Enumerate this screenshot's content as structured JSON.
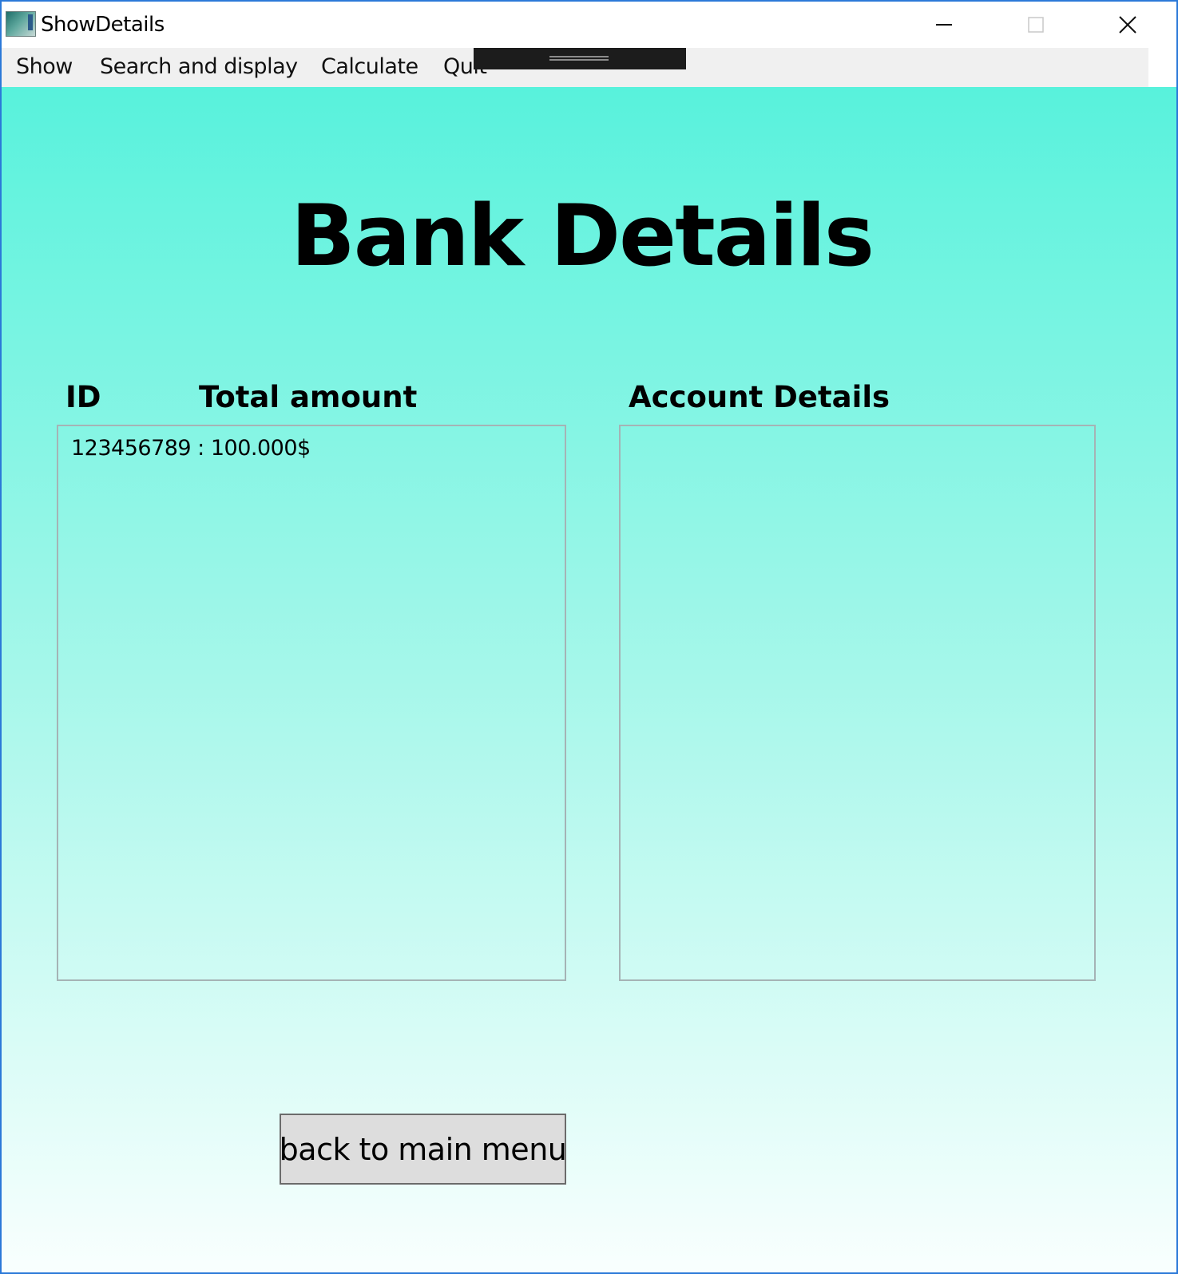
{
  "window": {
    "title": "ShowDetails"
  },
  "menu": {
    "items": [
      "Show",
      "Search and display",
      "Calculate",
      "Quit"
    ]
  },
  "main": {
    "heading": "Bank Details",
    "columns": {
      "id_label": "ID",
      "total_label": "Total amount",
      "account_label": "Account Details"
    },
    "summary_list": [
      "123456789 : 100.000$"
    ],
    "account_list": [],
    "back_button_label": "back to main menu"
  },
  "colors": {
    "gradient_top": "#58f2dc",
    "gradient_bottom": "#f9fffe",
    "window_border": "#2b79d8",
    "menubar_bg": "#f0f0f0",
    "button_bg": "#dddddd"
  },
  "icons": [
    "app-icon",
    "minimize-icon",
    "maximize-icon",
    "close-icon"
  ]
}
